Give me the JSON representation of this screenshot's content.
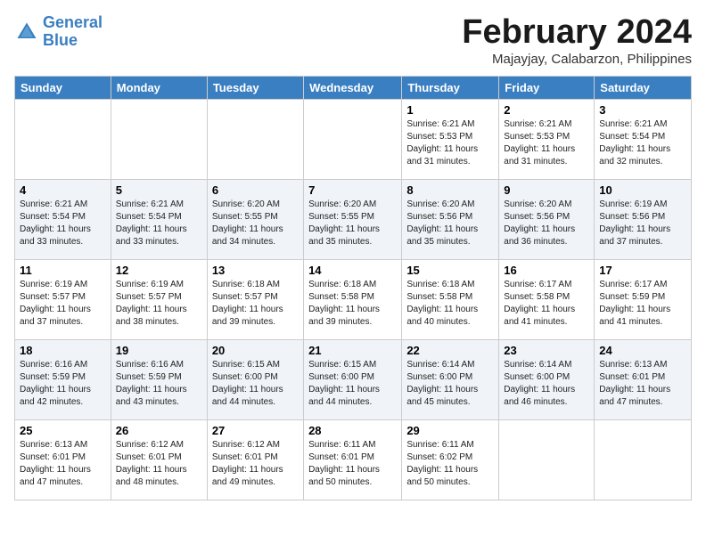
{
  "header": {
    "logo_line1": "General",
    "logo_line2": "Blue",
    "month_title": "February 2024",
    "location": "Majayjay, Calabarzon, Philippines"
  },
  "days_of_week": [
    "Sunday",
    "Monday",
    "Tuesday",
    "Wednesday",
    "Thursday",
    "Friday",
    "Saturday"
  ],
  "weeks": [
    [
      {
        "day": "",
        "info": ""
      },
      {
        "day": "",
        "info": ""
      },
      {
        "day": "",
        "info": ""
      },
      {
        "day": "",
        "info": ""
      },
      {
        "day": "1",
        "info": "Sunrise: 6:21 AM\nSunset: 5:53 PM\nDaylight: 11 hours\nand 31 minutes."
      },
      {
        "day": "2",
        "info": "Sunrise: 6:21 AM\nSunset: 5:53 PM\nDaylight: 11 hours\nand 31 minutes."
      },
      {
        "day": "3",
        "info": "Sunrise: 6:21 AM\nSunset: 5:54 PM\nDaylight: 11 hours\nand 32 minutes."
      }
    ],
    [
      {
        "day": "4",
        "info": "Sunrise: 6:21 AM\nSunset: 5:54 PM\nDaylight: 11 hours\nand 33 minutes."
      },
      {
        "day": "5",
        "info": "Sunrise: 6:21 AM\nSunset: 5:54 PM\nDaylight: 11 hours\nand 33 minutes."
      },
      {
        "day": "6",
        "info": "Sunrise: 6:20 AM\nSunset: 5:55 PM\nDaylight: 11 hours\nand 34 minutes."
      },
      {
        "day": "7",
        "info": "Sunrise: 6:20 AM\nSunset: 5:55 PM\nDaylight: 11 hours\nand 35 minutes."
      },
      {
        "day": "8",
        "info": "Sunrise: 6:20 AM\nSunset: 5:56 PM\nDaylight: 11 hours\nand 35 minutes."
      },
      {
        "day": "9",
        "info": "Sunrise: 6:20 AM\nSunset: 5:56 PM\nDaylight: 11 hours\nand 36 minutes."
      },
      {
        "day": "10",
        "info": "Sunrise: 6:19 AM\nSunset: 5:56 PM\nDaylight: 11 hours\nand 37 minutes."
      }
    ],
    [
      {
        "day": "11",
        "info": "Sunrise: 6:19 AM\nSunset: 5:57 PM\nDaylight: 11 hours\nand 37 minutes."
      },
      {
        "day": "12",
        "info": "Sunrise: 6:19 AM\nSunset: 5:57 PM\nDaylight: 11 hours\nand 38 minutes."
      },
      {
        "day": "13",
        "info": "Sunrise: 6:18 AM\nSunset: 5:57 PM\nDaylight: 11 hours\nand 39 minutes."
      },
      {
        "day": "14",
        "info": "Sunrise: 6:18 AM\nSunset: 5:58 PM\nDaylight: 11 hours\nand 39 minutes."
      },
      {
        "day": "15",
        "info": "Sunrise: 6:18 AM\nSunset: 5:58 PM\nDaylight: 11 hours\nand 40 minutes."
      },
      {
        "day": "16",
        "info": "Sunrise: 6:17 AM\nSunset: 5:58 PM\nDaylight: 11 hours\nand 41 minutes."
      },
      {
        "day": "17",
        "info": "Sunrise: 6:17 AM\nSunset: 5:59 PM\nDaylight: 11 hours\nand 41 minutes."
      }
    ],
    [
      {
        "day": "18",
        "info": "Sunrise: 6:16 AM\nSunset: 5:59 PM\nDaylight: 11 hours\nand 42 minutes."
      },
      {
        "day": "19",
        "info": "Sunrise: 6:16 AM\nSunset: 5:59 PM\nDaylight: 11 hours\nand 43 minutes."
      },
      {
        "day": "20",
        "info": "Sunrise: 6:15 AM\nSunset: 6:00 PM\nDaylight: 11 hours\nand 44 minutes."
      },
      {
        "day": "21",
        "info": "Sunrise: 6:15 AM\nSunset: 6:00 PM\nDaylight: 11 hours\nand 44 minutes."
      },
      {
        "day": "22",
        "info": "Sunrise: 6:14 AM\nSunset: 6:00 PM\nDaylight: 11 hours\nand 45 minutes."
      },
      {
        "day": "23",
        "info": "Sunrise: 6:14 AM\nSunset: 6:00 PM\nDaylight: 11 hours\nand 46 minutes."
      },
      {
        "day": "24",
        "info": "Sunrise: 6:13 AM\nSunset: 6:01 PM\nDaylight: 11 hours\nand 47 minutes."
      }
    ],
    [
      {
        "day": "25",
        "info": "Sunrise: 6:13 AM\nSunset: 6:01 PM\nDaylight: 11 hours\nand 47 minutes."
      },
      {
        "day": "26",
        "info": "Sunrise: 6:12 AM\nSunset: 6:01 PM\nDaylight: 11 hours\nand 48 minutes."
      },
      {
        "day": "27",
        "info": "Sunrise: 6:12 AM\nSunset: 6:01 PM\nDaylight: 11 hours\nand 49 minutes."
      },
      {
        "day": "28",
        "info": "Sunrise: 6:11 AM\nSunset: 6:01 PM\nDaylight: 11 hours\nand 50 minutes."
      },
      {
        "day": "29",
        "info": "Sunrise: 6:11 AM\nSunset: 6:02 PM\nDaylight: 11 hours\nand 50 minutes."
      },
      {
        "day": "",
        "info": ""
      },
      {
        "day": "",
        "info": ""
      }
    ]
  ]
}
